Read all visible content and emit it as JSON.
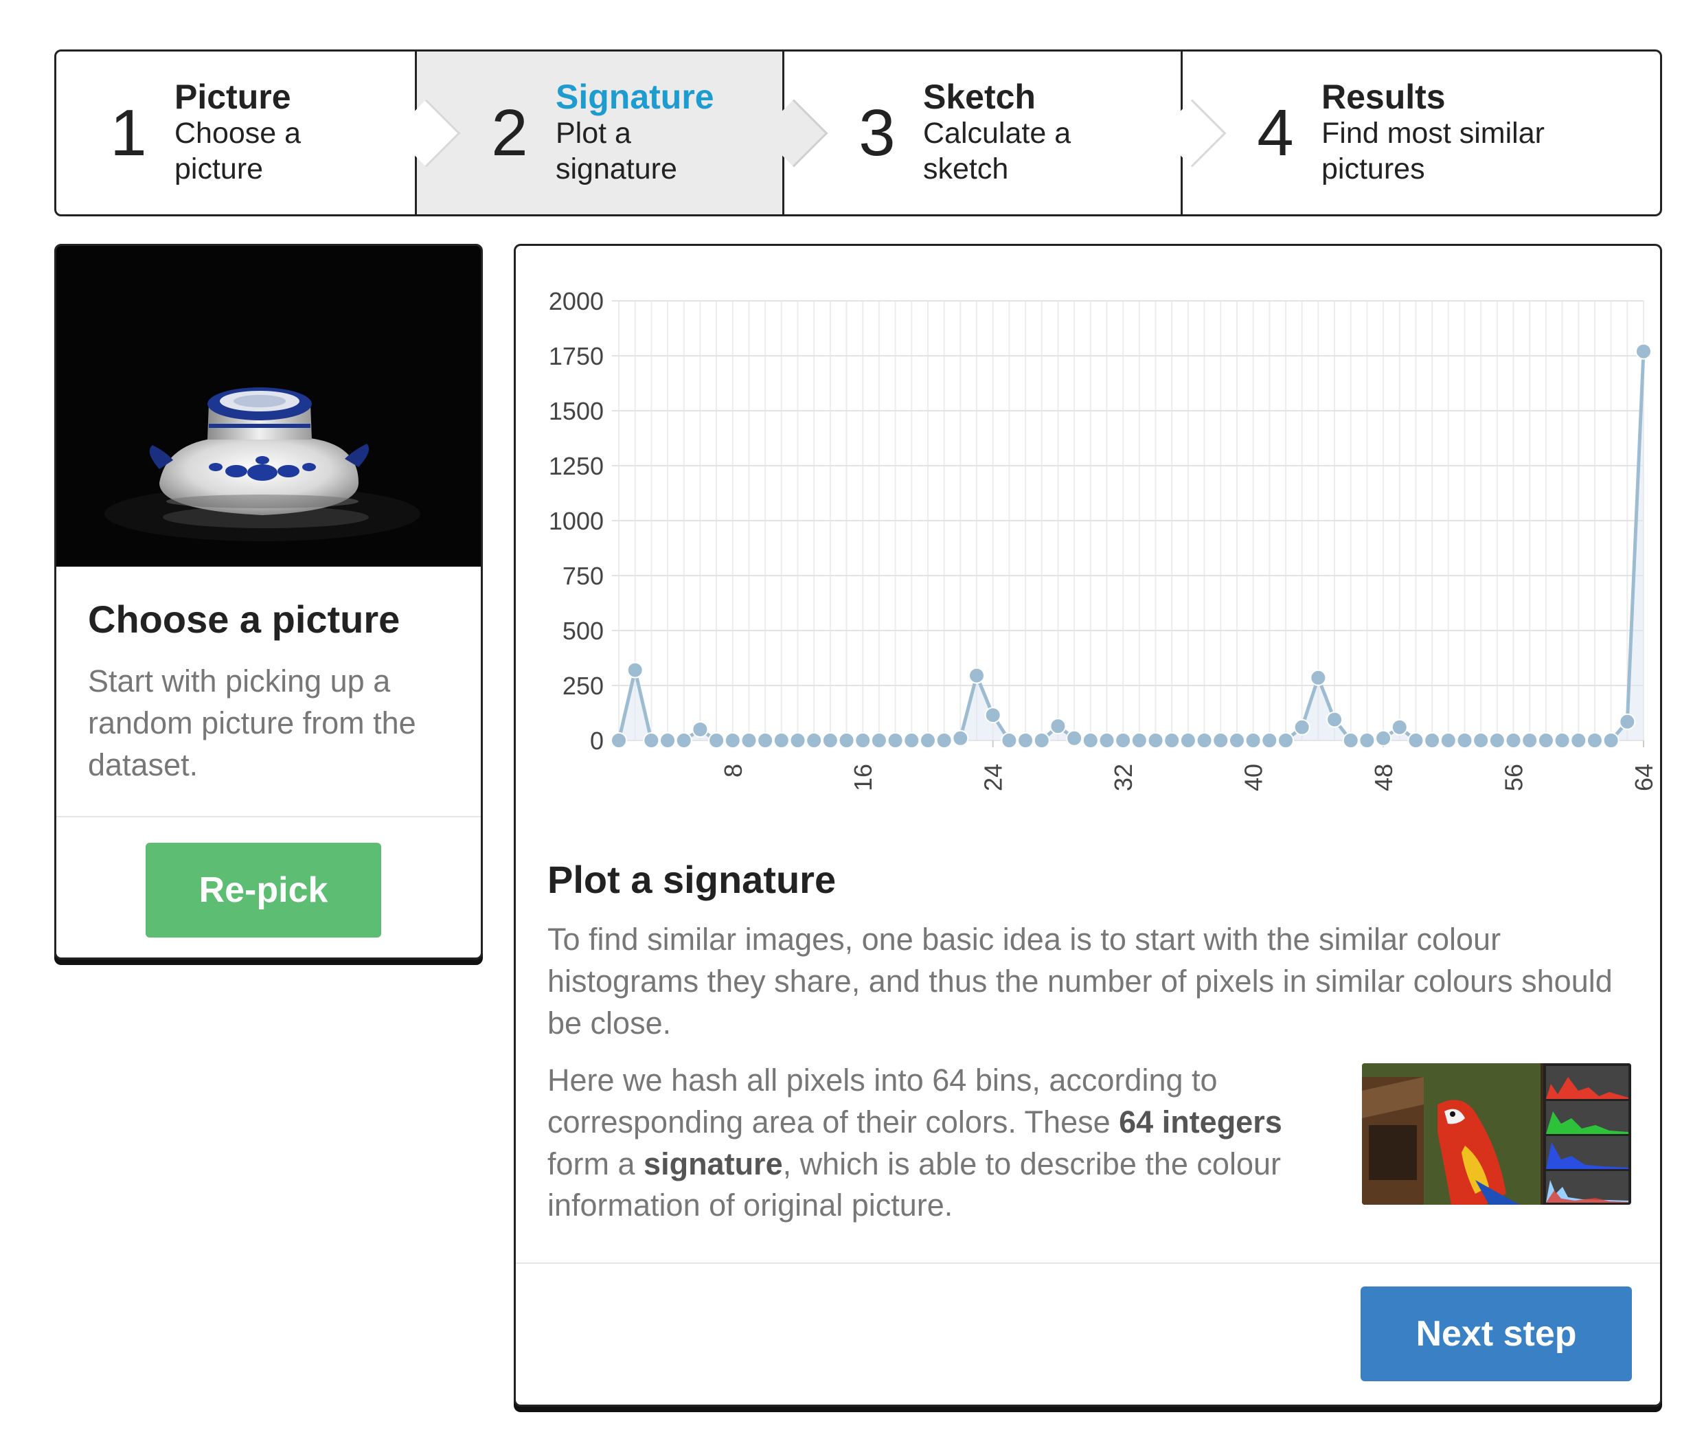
{
  "steps": [
    {
      "number": "1",
      "title": "Picture",
      "desc_line1": "Choose a",
      "desc_line2": "picture",
      "active": false
    },
    {
      "number": "2",
      "title": "Signature",
      "desc_line1": "Plot a",
      "desc_line2": "signature",
      "active": true
    },
    {
      "number": "3",
      "title": "Sketch",
      "desc_line1": "Calculate a",
      "desc_line2": "sketch",
      "active": false
    },
    {
      "number": "4",
      "title": "Results",
      "desc_line1": "Find most similar",
      "desc_line2": "pictures",
      "active": false
    }
  ],
  "picture_card": {
    "title": "Choose a picture",
    "description": "Start with picking up a random picture from the dataset.",
    "button_label": "Re-pick"
  },
  "signature_card": {
    "title": "Plot a signature",
    "paragraph1": "To find similar images, one basic idea is to start with the similar colour histograms they share, and thus the number of pixels in similar colours should be close.",
    "paragraph2_part1": "Here we hash all pixels into 64 bins, according to corresponding area of their colors. These ",
    "paragraph2_bold1": "64 integers",
    "paragraph2_part2": " form a ",
    "paragraph2_bold2": "signature",
    "paragraph2_part3": ", which is able to describe the colour information of original picture.",
    "button_label": "Next step"
  },
  "colors": {
    "accent": "#1e9bcf",
    "repick_button": "#5cbd73",
    "next_button": "#3a80c4",
    "series": "#9dbcd2"
  },
  "chart_data": {
    "type": "area",
    "x": [
      1,
      2,
      3,
      4,
      5,
      6,
      7,
      8,
      9,
      10,
      11,
      12,
      13,
      14,
      15,
      16,
      17,
      18,
      19,
      20,
      21,
      22,
      23,
      24,
      25,
      26,
      27,
      28,
      29,
      30,
      31,
      32,
      33,
      34,
      35,
      36,
      37,
      38,
      39,
      40,
      41,
      42,
      43,
      44,
      45,
      46,
      47,
      48,
      49,
      50,
      51,
      52,
      53,
      54,
      55,
      56,
      57,
      58,
      59,
      60,
      61,
      62,
      63,
      64
    ],
    "values": [
      0,
      320,
      0,
      0,
      0,
      50,
      0,
      0,
      0,
      0,
      0,
      0,
      0,
      0,
      0,
      0,
      0,
      0,
      0,
      0,
      0,
      10,
      295,
      115,
      0,
      0,
      0,
      65,
      10,
      0,
      0,
      0,
      0,
      0,
      0,
      0,
      0,
      0,
      0,
      0,
      0,
      0,
      60,
      285,
      95,
      0,
      0,
      10,
      60,
      0,
      0,
      0,
      0,
      0,
      0,
      0,
      0,
      0,
      0,
      0,
      0,
      0,
      85,
      1770
    ],
    "x_ticks": [
      "8",
      "16",
      "24",
      "32",
      "40",
      "48",
      "56",
      "64"
    ],
    "y_ticks": [
      "0",
      "250",
      "500",
      "750",
      "1000",
      "1250",
      "1500",
      "1750",
      "2000"
    ],
    "ylim": [
      0,
      2000
    ],
    "xlim": [
      1,
      64
    ],
    "grid": true
  }
}
